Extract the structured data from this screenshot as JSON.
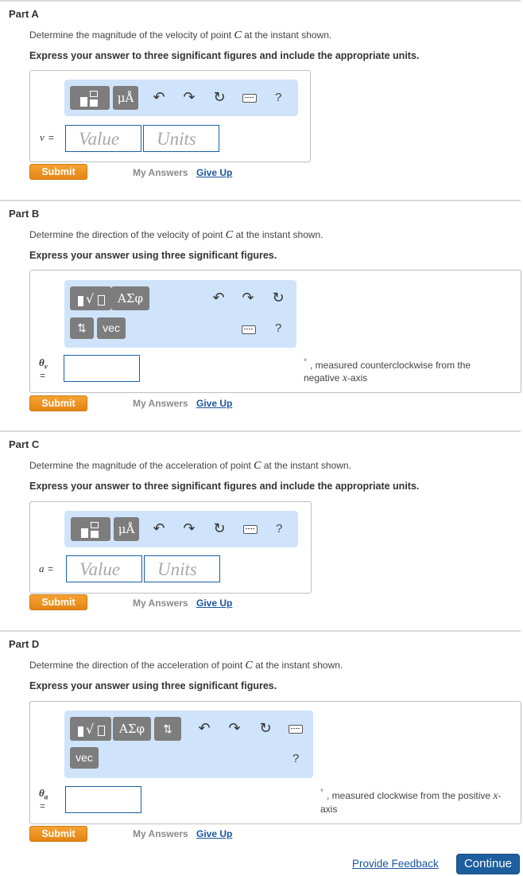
{
  "parts": [
    {
      "title": "Part A",
      "question_pre": "Determine the magnitude of the velocity of point ",
      "point": "C",
      "question_post": " at the instant shown.",
      "instruction": "Express your answer to three significant figures and include the appropriate units.",
      "variable": "v",
      "equals": "=",
      "value_placeholder": "Value",
      "units_placeholder": "Units",
      "toolbar": {
        "units_btn": "μÅ",
        "help": "?"
      }
    },
    {
      "title": "Part B",
      "question_pre": "Determine the direction of the velocity of point ",
      "point": "C",
      "question_post": " at the instant shown.",
      "instruction": "Express your answer using three significant figures.",
      "variable": "θ",
      "subscript": "v",
      "equals": "=",
      "unit_degree": "°",
      "unit_text_pre": ", measured counterclockwise from the negative ",
      "axis": "x",
      "unit_text_post": "-axis",
      "toolbar": {
        "greek_btn": "ΑΣφ",
        "sort_btn": "⇅",
        "vec_btn": "vec",
        "help": "?"
      }
    },
    {
      "title": "Part C",
      "question_pre": "Determine the magnitude of the acceleration of point ",
      "point": "C",
      "question_post": " at the instant shown.",
      "instruction": "Express your answer to three significant figures and include the appropriate units.",
      "variable": "a",
      "equals": "=",
      "value_placeholder": "Value",
      "units_placeholder": "Units",
      "toolbar": {
        "units_btn": "μÅ",
        "help": "?"
      }
    },
    {
      "title": "Part D",
      "question_pre": "Determine the direction of the acceleration of point ",
      "point": "C",
      "question_post": " at the instant shown.",
      "instruction": "Express your answer using three significant figures.",
      "variable": "θ",
      "subscript": "a",
      "equals": "=",
      "unit_degree": "°",
      "unit_text_pre": ", measured clockwise from the positive ",
      "axis": "x",
      "unit_text_post": "-axis",
      "toolbar": {
        "greek_btn": "ΑΣφ",
        "sort_btn": "⇅",
        "vec_btn": "vec",
        "help": "?"
      }
    }
  ],
  "actions": {
    "submit": "Submit",
    "my_answers": "My Answers",
    "give_up": "Give Up"
  },
  "footer": {
    "feedback": "Provide Feedback",
    "continue": "Continue"
  },
  "icons": {
    "undo": "↶",
    "redo": "↷",
    "reset": "↻",
    "keyboard": "keyboard-icon",
    "template": "template-icon",
    "sqrt": "sqrt-template-icon"
  },
  "colors": {
    "submit": "#f0921f",
    "continue": "#1d5e9e",
    "toolbar": "#cfe4fb",
    "link": "#1a55a0"
  }
}
